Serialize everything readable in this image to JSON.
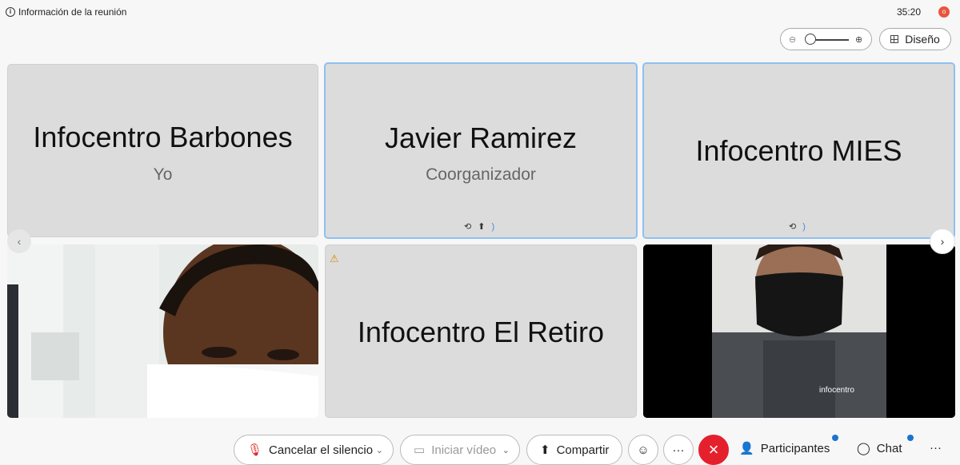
{
  "topbar": {
    "meeting_info": "Información de la reunión",
    "timer": "35:20",
    "rec_label": "o"
  },
  "view": {
    "layout_label": "Diseño",
    "zoom_level": 0.0
  },
  "participants": [
    {
      "name": "Infocentro Barbones",
      "role": "Yo"
    },
    {
      "name": "Javier Ramirez",
      "role": "Coorganizador"
    },
    {
      "name": "Infocentro MIES",
      "role": ""
    },
    {
      "name": "",
      "role": ""
    },
    {
      "name": "Infocentro El Retiro",
      "role": ""
    },
    {
      "name": "",
      "role": ""
    }
  ],
  "controls": {
    "mute": "Cancelar el silencio",
    "video": "Iniciar vídeo",
    "share": "Compartir",
    "more": "···",
    "participants": "Participantes",
    "chat": "Chat"
  },
  "colors": {
    "end_call": "#e5202d",
    "active_border": "#8fc0f0",
    "notification": "#1a73d0"
  }
}
